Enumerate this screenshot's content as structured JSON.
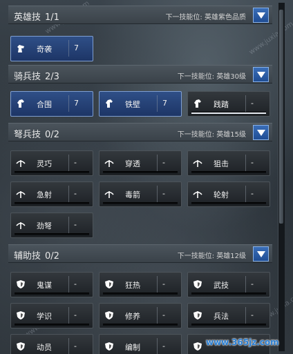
{
  "sections": [
    {
      "title": "英雄技",
      "count": "1/1",
      "next": "下一技能位: 英雄紫色品质",
      "icon": "horse-icon",
      "skills": [
        {
          "name": "奇袭",
          "level": "7",
          "active": true
        }
      ]
    },
    {
      "title": "骑兵技",
      "count": "2/3",
      "next": "下一技能位: 英雄30级",
      "icon": "horse-head-icon",
      "skills": [
        {
          "name": "合围",
          "level": "7",
          "active": true
        },
        {
          "name": "铁壁",
          "level": "7",
          "active": true
        },
        {
          "name": "践踏",
          "level": "-",
          "active": false
        }
      ]
    },
    {
      "title": "弩兵技",
      "count": "0/2",
      "next": "下一技能位: 英雄15级",
      "icon": "crossbow-icon",
      "skills": [
        {
          "name": "灵巧",
          "level": "-",
          "active": false
        },
        {
          "name": "穿透",
          "level": "-",
          "active": false
        },
        {
          "name": "狙击",
          "level": "-",
          "active": false
        },
        {
          "name": "急射",
          "level": "-",
          "active": false
        },
        {
          "name": "毒箭",
          "level": "-",
          "active": false
        },
        {
          "name": "轮射",
          "level": "-",
          "active": false
        },
        {
          "name": "劲弩",
          "level": "-",
          "active": false
        }
      ]
    },
    {
      "title": "辅助技",
      "count": "0/2",
      "next": "下一技能位: 英雄12级",
      "icon": "shield-icon",
      "skills": [
        {
          "name": "鬼谋",
          "level": "-",
          "active": false
        },
        {
          "name": "狂热",
          "level": "-",
          "active": false
        },
        {
          "name": "武技",
          "level": "-",
          "active": false
        },
        {
          "name": "学识",
          "level": "-",
          "active": false
        },
        {
          "name": "修养",
          "level": "-",
          "active": false
        },
        {
          "name": "兵法",
          "level": "-",
          "active": false
        },
        {
          "name": "动员",
          "level": "-",
          "active": false
        },
        {
          "name": "编制",
          "level": "-",
          "active": false
        },
        {
          "name": "",
          "level": "-",
          "active": false
        }
      ]
    }
  ],
  "watermarks": {
    "juxia": "www.juxia.com",
    "site": "www.365jz.com"
  },
  "colors": {
    "active_skill": "#2f4f87",
    "header": "#4b545c",
    "dropdown": "#2a5ca8"
  }
}
